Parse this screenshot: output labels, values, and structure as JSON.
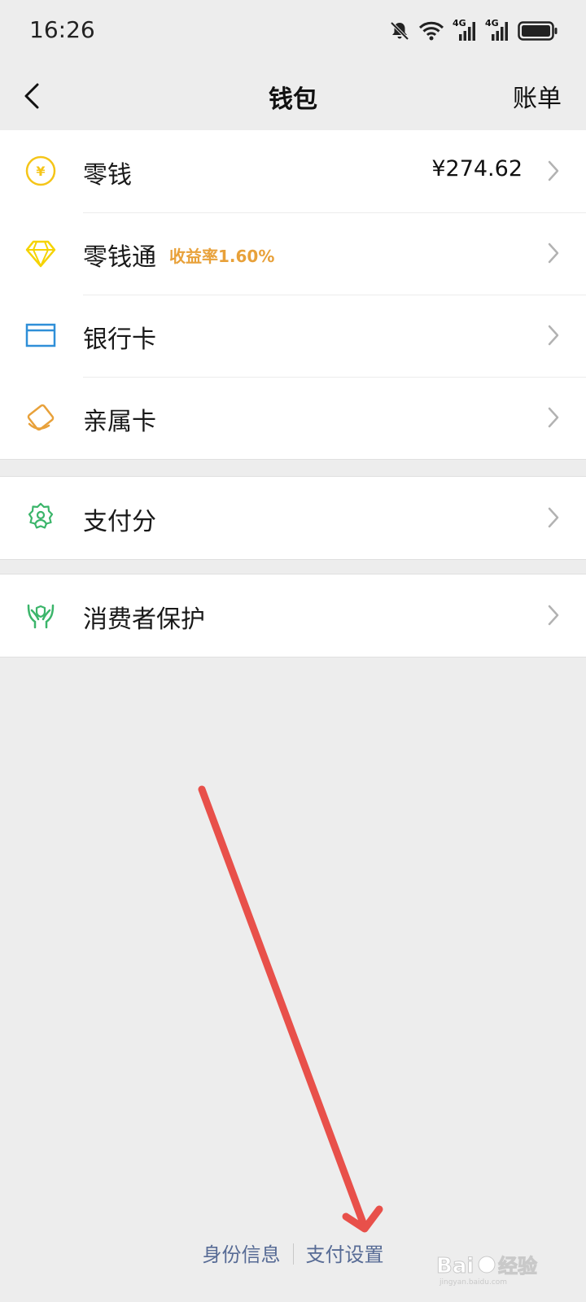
{
  "status_bar": {
    "time": "16:26",
    "net1": "4G",
    "net2": "4G",
    "icons": [
      "bell-muted-icon",
      "wifi-icon",
      "signal-icon",
      "signal-icon",
      "battery-icon"
    ]
  },
  "nav": {
    "title": "钱包",
    "right_label": "账单",
    "back_icon": "chevron-left-icon"
  },
  "groups": [
    {
      "items": [
        {
          "label": "零钱",
          "value": "¥274.62",
          "icon": "yuan-coin-icon",
          "icon_color": "#f5c518"
        },
        {
          "label": "零钱通",
          "tag": "收益率1.60%",
          "icon": "diamond-icon",
          "icon_color": "#f5d300"
        },
        {
          "label": "银行卡",
          "icon": "bank-card-icon",
          "icon_color": "#2f8fd8"
        },
        {
          "label": "亲属卡",
          "icon": "family-card-icon",
          "icon_color": "#e8a13a"
        }
      ]
    },
    {
      "items": [
        {
          "label": "支付分",
          "icon": "pay-score-icon",
          "icon_color": "#3bb56a"
        }
      ]
    },
    {
      "items": [
        {
          "label": "消费者保护",
          "icon": "protection-hands-icon",
          "icon_color": "#3bb56a"
        }
      ]
    }
  ],
  "footer": {
    "identity_label": "身份信息",
    "pay_settings_label": "支付设置"
  },
  "watermark": {
    "text": "Baidu经验",
    "sub": "jingyan.baidu.com"
  },
  "colors": {
    "accent_link": "#576b95",
    "arrow": "#e8504a",
    "tag": "#e8a13a"
  }
}
